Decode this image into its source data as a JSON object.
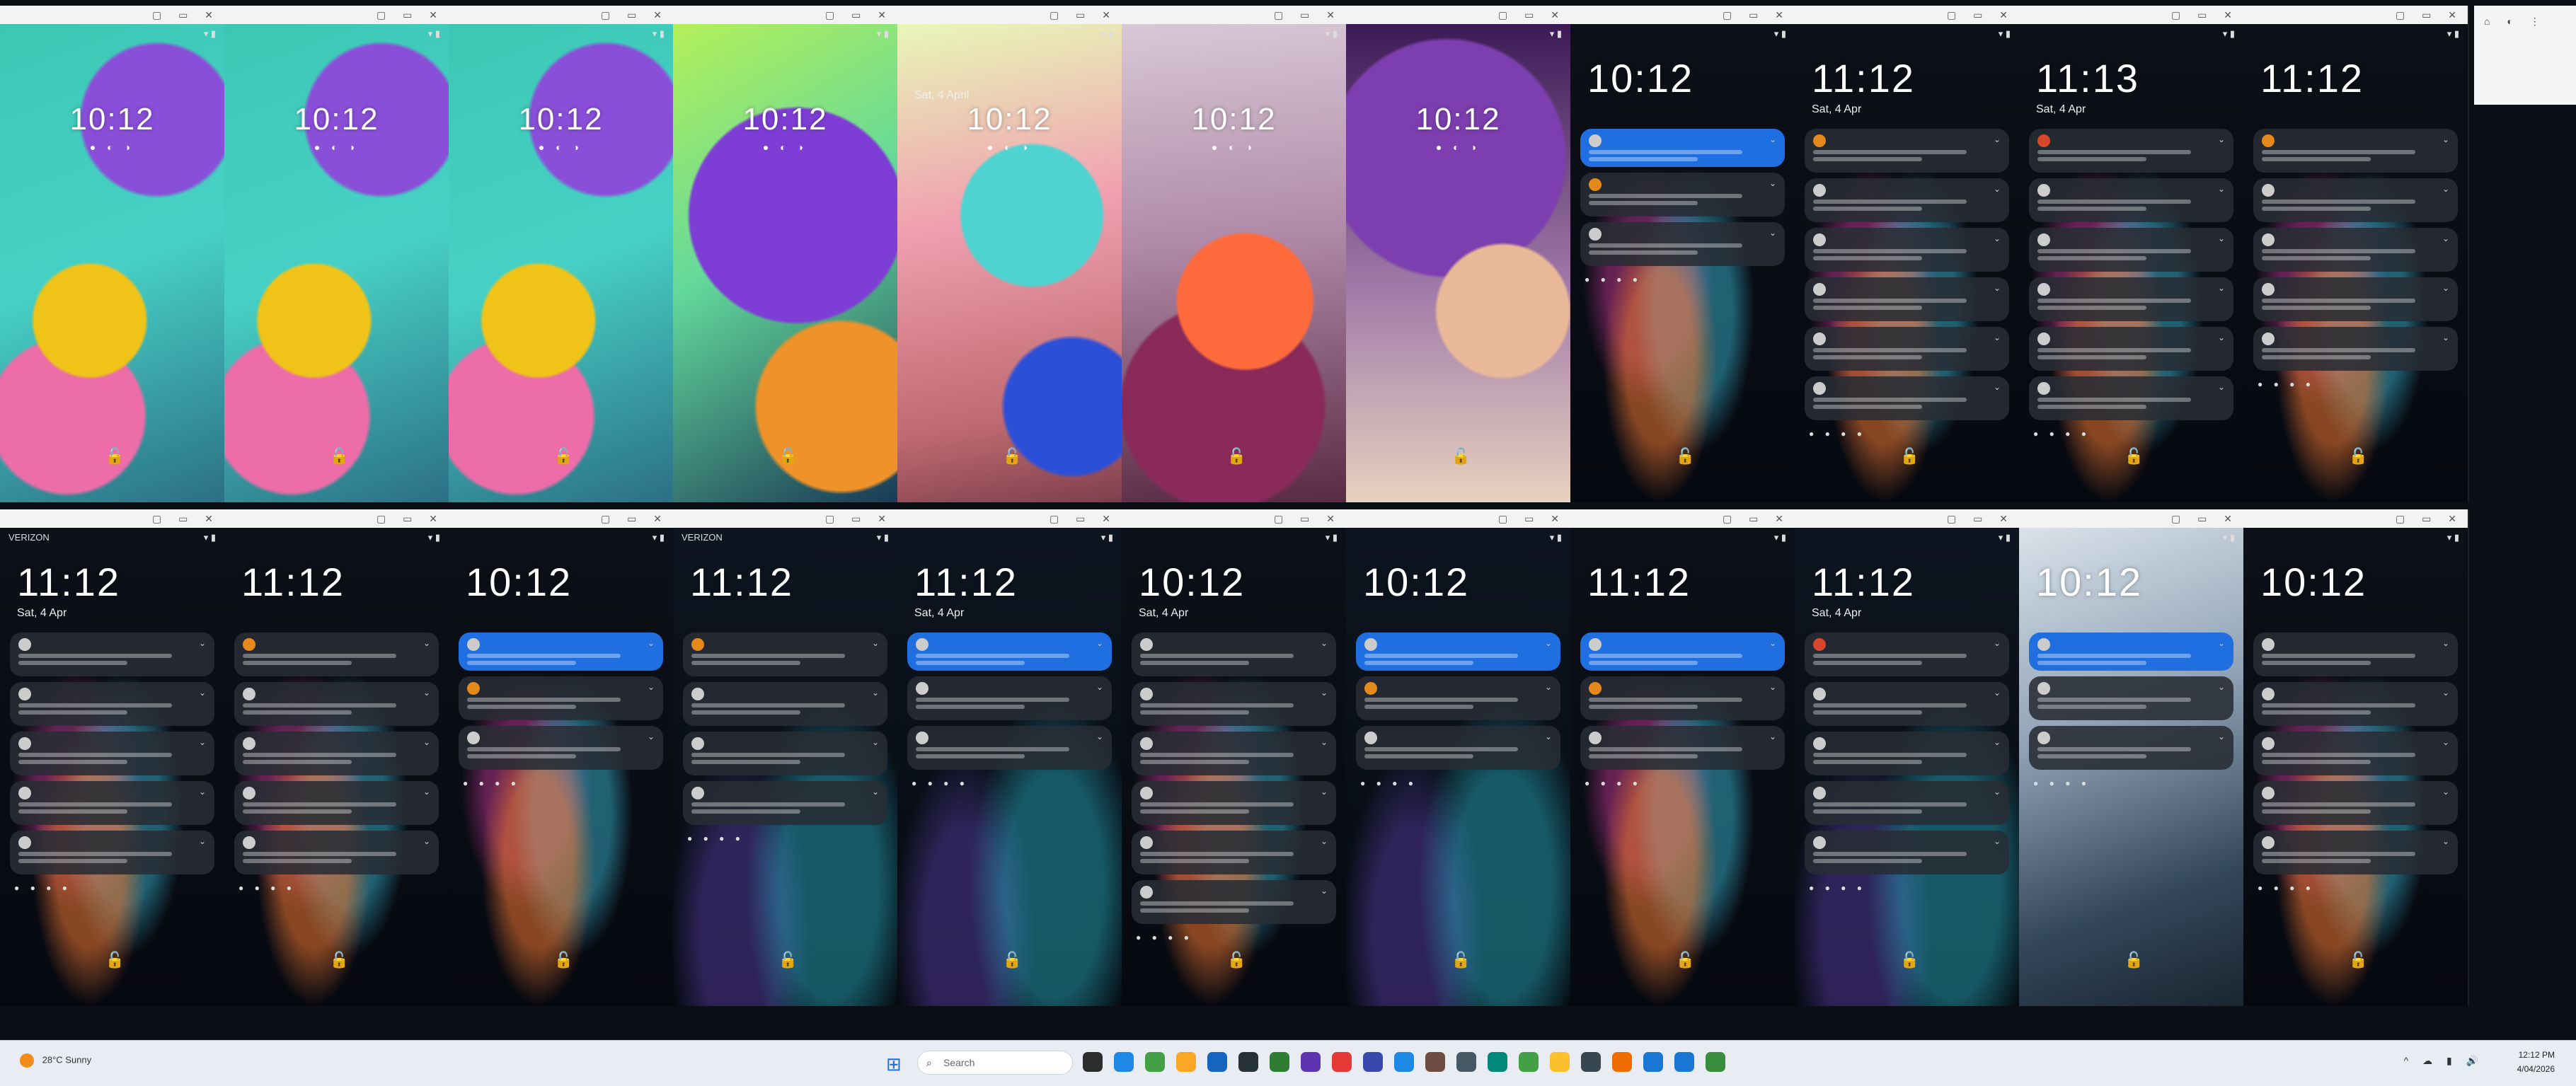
{
  "phones": [
    {
      "id": "p1",
      "carrier": "",
      "clock": "10:12",
      "date": "",
      "wallpaper": "teal",
      "notifs": []
    },
    {
      "id": "p2",
      "carrier": "",
      "clock": "10:12",
      "date": "",
      "wallpaper": "teal",
      "notifs": []
    },
    {
      "id": "p3",
      "carrier": "",
      "clock": "10:12",
      "date": "",
      "wallpaper": "teal",
      "notifs": []
    },
    {
      "id": "p4",
      "carrier": "",
      "clock": "10:12",
      "date": "",
      "wallpaper": "lime",
      "notifs": []
    },
    {
      "id": "p5",
      "carrier": "",
      "clock": "10:12",
      "date": "Sat, 4 April",
      "wallpaper": "pastel",
      "notifs": []
    },
    {
      "id": "p6",
      "carrier": "",
      "clock": "10:12",
      "date": "",
      "wallpaper": "flower",
      "notifs": []
    },
    {
      "id": "p7",
      "carrier": "",
      "clock": "10:12",
      "date": "",
      "wallpaper": "purplesoft",
      "notifs": []
    },
    {
      "id": "p8",
      "carrier": "",
      "clock": "10:12",
      "date": "",
      "wallpaper": "dark",
      "notifs": [
        "blue",
        "orange",
        "plain"
      ]
    },
    {
      "id": "p9",
      "carrier": "",
      "clock": "11:12",
      "date": "Sat, 4 Apr",
      "wallpaper": "dark",
      "notifs": [
        "orange",
        "plain",
        "plain",
        "plain",
        "plain",
        "plain"
      ]
    },
    {
      "id": "p10",
      "carrier": "",
      "clock": "11:13",
      "date": "Sat, 4 Apr",
      "wallpaper": "dark",
      "notifs": [
        "red",
        "plain",
        "plain",
        "plain",
        "plain",
        "plain"
      ]
    },
    {
      "id": "p11",
      "carrier": "",
      "clock": "11:12",
      "date": "",
      "wallpaper": "dark",
      "notifs": [
        "orange",
        "plain",
        "plain",
        "plain",
        "plain"
      ]
    },
    {
      "id": "p12",
      "carrier": "VERIZON",
      "clock": "11:12",
      "date": "Sat, 4 Apr",
      "wallpaper": "dark",
      "notifs": [
        "plain",
        "plain",
        "plain",
        "plain",
        "plain"
      ]
    },
    {
      "id": "p13",
      "carrier": "",
      "clock": "11:12",
      "date": "",
      "wallpaper": "dark",
      "notifs": [
        "orange",
        "plain",
        "plain",
        "plain",
        "plain"
      ]
    },
    {
      "id": "p14",
      "carrier": "",
      "clock": "10:12",
      "date": "",
      "wallpaper": "dark",
      "notifs": [
        "blue",
        "orange",
        "plain"
      ]
    },
    {
      "id": "p15",
      "carrier": "VERIZON",
      "clock": "11:12",
      "date": "",
      "wallpaper": "dark2",
      "notifs": [
        "orange",
        "plain",
        "plain",
        "plain"
      ]
    },
    {
      "id": "p16",
      "carrier": "",
      "clock": "11:12",
      "date": "Sat, 4 Apr",
      "wallpaper": "dark2",
      "notifs": [
        "blue",
        "plain",
        "plain"
      ]
    },
    {
      "id": "p17",
      "carrier": "",
      "clock": "10:12",
      "date": "Sat, 4 Apr",
      "wallpaper": "dark",
      "notifs": [
        "plain",
        "plain",
        "plain",
        "plain",
        "plain",
        "plain"
      ]
    },
    {
      "id": "p18",
      "carrier": "",
      "clock": "10:12",
      "date": "",
      "wallpaper": "dark2",
      "notifs": [
        "blue",
        "orange",
        "plain"
      ]
    },
    {
      "id": "p19",
      "carrier": "",
      "clock": "11:12",
      "date": "",
      "wallpaper": "dark",
      "notifs": [
        "blue",
        "orange",
        "plain"
      ]
    },
    {
      "id": "p20",
      "carrier": "",
      "clock": "11:12",
      "date": "Sat, 4 Apr",
      "wallpaper": "dark2",
      "notifs": [
        "red",
        "plain",
        "plain",
        "plain",
        "plain"
      ]
    },
    {
      "id": "p21",
      "carrier": "",
      "clock": "10:12",
      "date": "",
      "wallpaper": "wave",
      "notifs": [
        "blue",
        "plain",
        "plain"
      ]
    },
    {
      "id": "p22",
      "carrier": "",
      "clock": "10:12",
      "date": "",
      "wallpaper": "dark",
      "notifs": [
        "plain",
        "plain",
        "plain",
        "plain",
        "plain"
      ]
    }
  ],
  "taskbar": {
    "weather_temp": "28°C",
    "weather_text": "Sunny",
    "search_placeholder": "Search",
    "time": "12:12 PM",
    "date": "4/04/2026"
  },
  "colors": {
    "blue_notification": "#1f6fe0",
    "orange_icon": "#e58a1a",
    "taskbar_bg": "#e9edf3"
  }
}
